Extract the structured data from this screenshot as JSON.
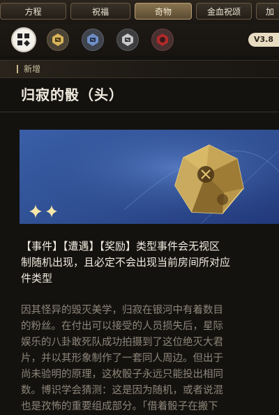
{
  "tabs": [
    "方程",
    "祝福",
    "奇物",
    "金血祝颂",
    "加"
  ],
  "active_tab": "奇物",
  "version": "V3.8",
  "section": "新增",
  "item": {
    "name": "归寂的骰（头）",
    "tags_description": "【事件】【遭遇】【奖励】类型事件会无视区制随机出现，且必定不会出现当前房间所对应件类型",
    "lines_tags": [
      "【事件】【遭遇】【奖励】类型事件会无视区",
      "制随机出现，且必定不会出现当前房间所对应",
      "件类型"
    ],
    "lore_lines": [
      "因其怪异的毁灭美学，归寂在银河中有着数目",
      "的粉丝。在付出可以接受的人员损失后，星际",
      "娱乐的八卦敢死队成功拍摄到了这位绝灭大君",
      "片，并以其形象制作了一套同人周边。但出于",
      "尚未验明的原理，这枚骰子永远只能投出相同",
      "数。博识学会猜测：这是因为随机，或者说混",
      "也是孜怖的重要组成部分。「借着骰子在搬下"
    ]
  },
  "icons": {
    "menu": "grid-diamond-icon",
    "filters": [
      "gold-badge-icon",
      "blue-badge-icon",
      "gray-badge-icon",
      "red-badge-icon"
    ],
    "sparkle": "sparkle-icon"
  },
  "colors": {
    "card_blue": "#3458a3",
    "gold": "#c9a85a",
    "accent_red": "#b02a2a"
  }
}
